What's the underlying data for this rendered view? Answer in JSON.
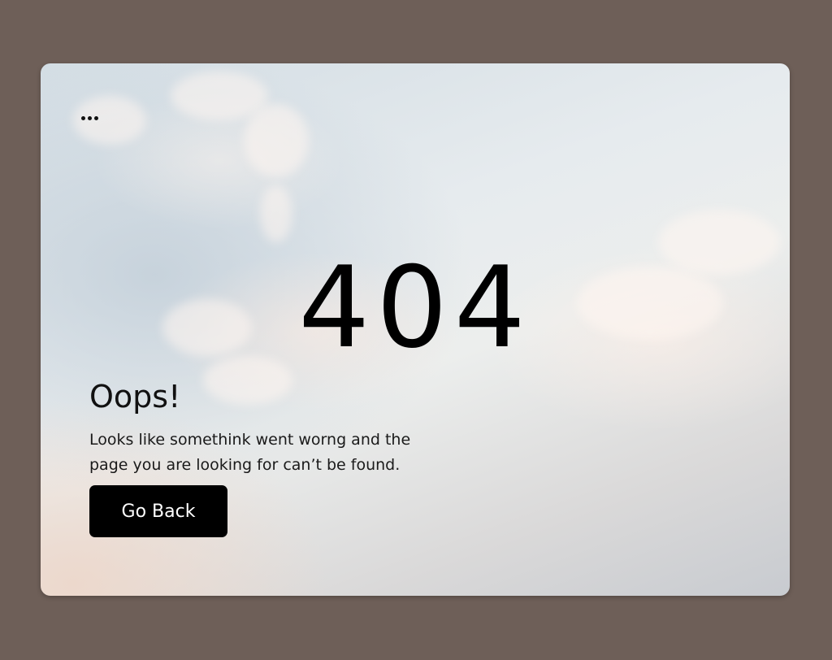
{
  "page": {
    "error_code": "404",
    "title": "Oops!",
    "message": "Looks like somethink went worng and the page you are looking for can’t be found.",
    "back_button_label": "Go Back",
    "menu_icon": "more-horizontal-icon"
  },
  "colors": {
    "backdrop": "#6e5f58",
    "button_bg": "#000000",
    "button_text": "#ffffff",
    "text": "#000000"
  }
}
